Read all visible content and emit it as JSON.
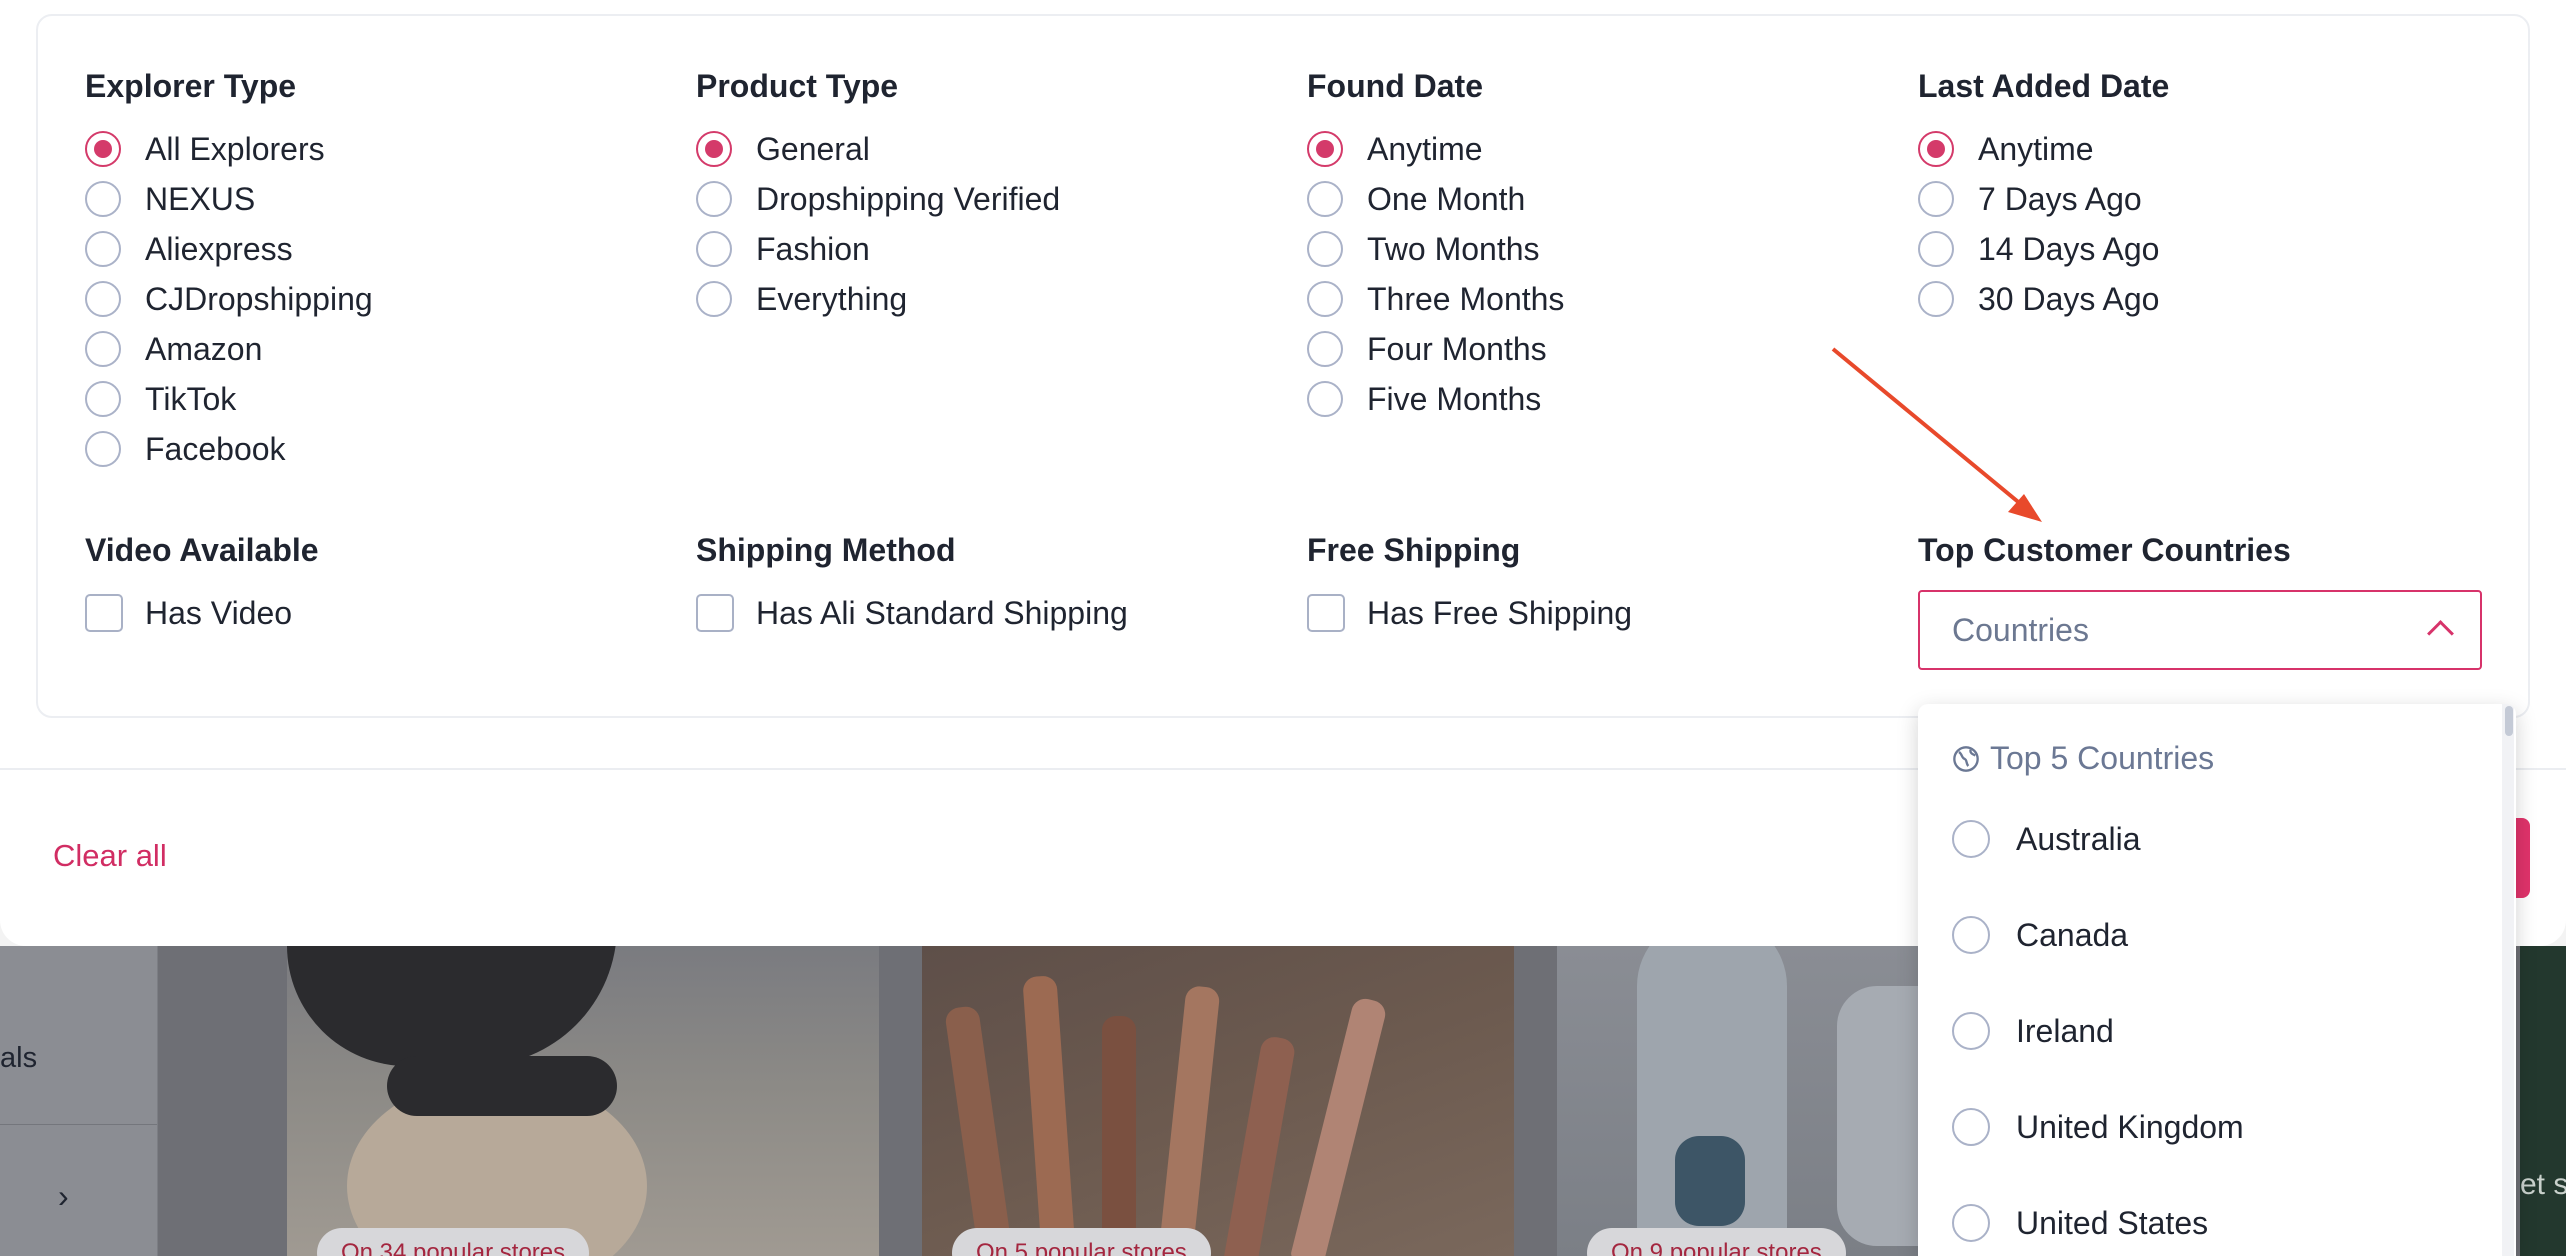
{
  "filters": {
    "explorer_type": {
      "title": "Explorer Type",
      "options": [
        "All Explorers",
        "NEXUS",
        "Aliexpress",
        "CJDropshipping",
        "Amazon",
        "TikTok",
        "Facebook"
      ],
      "selected": "All Explorers"
    },
    "product_type": {
      "title": "Product Type",
      "options": [
        "General",
        "Dropshipping Verified",
        "Fashion",
        "Everything"
      ],
      "selected": "General"
    },
    "found_date": {
      "title": "Found Date",
      "options": [
        "Anytime",
        "One Month",
        "Two Months",
        "Three Months",
        "Four Months",
        "Five Months"
      ],
      "selected": "Anytime"
    },
    "last_added_date": {
      "title": "Last Added Date",
      "options": [
        "Anytime",
        "7 Days Ago",
        "14 Days Ago",
        "30 Days Ago"
      ],
      "selected": "Anytime"
    },
    "video_available": {
      "title": "Video Available",
      "label": "Has Video",
      "checked": false
    },
    "shipping_method": {
      "title": "Shipping Method",
      "label": "Has Ali Standard Shipping",
      "checked": false
    },
    "free_shipping": {
      "title": "Free Shipping",
      "label": "Has Free Shipping",
      "checked": false
    },
    "top_customer_countries": {
      "title": "Top Customer Countries",
      "placeholder": "Countries",
      "dropdown": {
        "group_label": "Top 5 Countries",
        "options": [
          "Australia",
          "Canada",
          "Ireland",
          "United Kingdom",
          "United States"
        ]
      }
    }
  },
  "footer": {
    "clear_all": "Clear all"
  },
  "background": {
    "sidebar_label": "als",
    "card_badges": [
      "On 34 popular stores",
      "On 5 popular stores",
      "On 9 popular stores"
    ],
    "right_peek": "et s"
  },
  "colors": {
    "accent": "#d43a6a",
    "annotation_arrow": "#e8492b"
  }
}
